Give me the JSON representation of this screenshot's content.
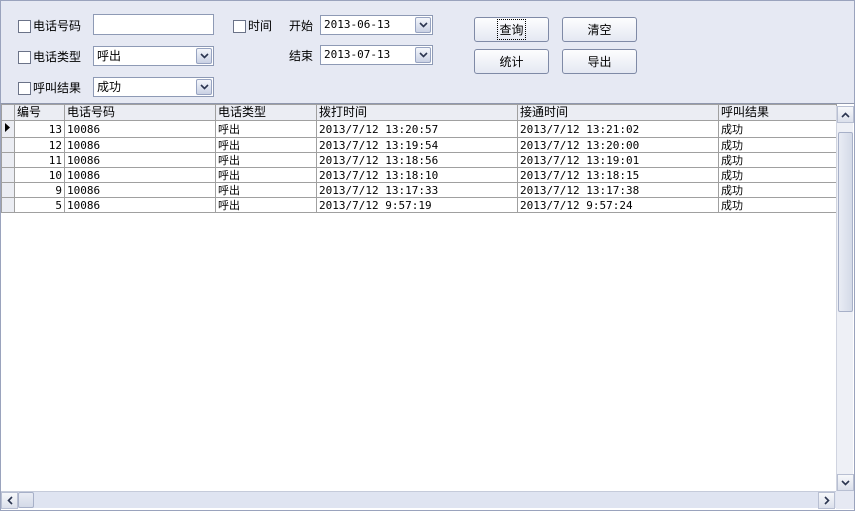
{
  "filters": {
    "phone_number": {
      "label": "电话号码",
      "checked": false,
      "value": ""
    },
    "call_type": {
      "label": "电话类型",
      "checked": false,
      "selected": "呼出"
    },
    "call_result": {
      "label": "呼叫结果",
      "checked": false,
      "selected": "成功"
    },
    "time": {
      "label": "时间",
      "checked": false
    },
    "start": {
      "label": "开始",
      "value": "2013-06-13"
    },
    "end": {
      "label": "结束",
      "value": "2013-07-13"
    }
  },
  "buttons": {
    "query": "查询",
    "clear": "清空",
    "stats": "统计",
    "export": "导出"
  },
  "table": {
    "columns": [
      "编号",
      "电话号码",
      "电话类型",
      "拨打时间",
      "接通时间",
      "呼叫结果"
    ],
    "rows": [
      [
        "13",
        "10086",
        "呼出",
        "2013/7/12 13:20:57",
        "2013/7/12 13:21:02",
        "成功"
      ],
      [
        "12",
        "10086",
        "呼出",
        "2013/7/12 13:19:54",
        "2013/7/12 13:20:00",
        "成功"
      ],
      [
        "11",
        "10086",
        "呼出",
        "2013/7/12 13:18:56",
        "2013/7/12 13:19:01",
        "成功"
      ],
      [
        "10",
        "10086",
        "呼出",
        "2013/7/12 13:18:10",
        "2013/7/12 13:18:15",
        "成功"
      ],
      [
        "9",
        "10086",
        "呼出",
        "2013/7/12 13:17:33",
        "2013/7/12 13:17:38",
        "成功"
      ],
      [
        "5",
        "10086",
        "呼出",
        "2013/7/12 9:57:19",
        "2013/7/12 9:57:24",
        "成功"
      ]
    ],
    "current_row": 0
  },
  "icons": {
    "dropdown": "chevron-down-icon",
    "row_pointer": "triangle-right-icon",
    "scroll_up": "chevron-up-icon",
    "scroll_down": "chevron-down-icon",
    "scroll_left": "chevron-left-icon",
    "scroll_right": "chevron-right-icon"
  },
  "colors": {
    "panel_bg": "#e6e9f3",
    "header_bg": "#ebedf3",
    "grid_line": "#a0a0a0"
  }
}
